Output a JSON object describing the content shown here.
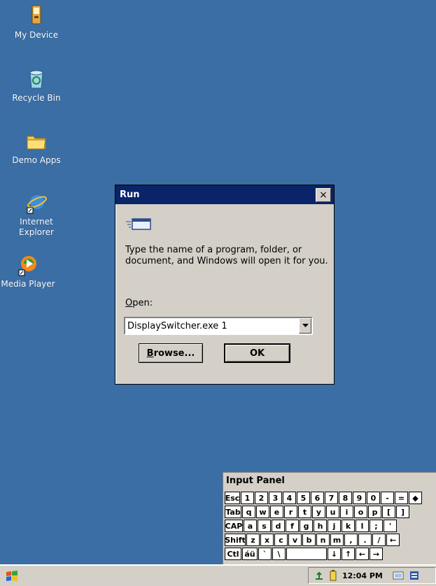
{
  "desktop": {
    "icons": [
      {
        "label": "My Device",
        "icon": "device-icon"
      },
      {
        "label": "Recycle Bin",
        "icon": "recycle-bin-icon"
      },
      {
        "label": "Demo Apps",
        "icon": "folder-icon"
      },
      {
        "label": "Internet Explorer",
        "icon": "internet-explorer-icon"
      },
      {
        "label": "Media Player",
        "icon": "media-player-icon"
      }
    ]
  },
  "run_dialog": {
    "title": "Run",
    "close_label": "×",
    "description": "Type the name of a program, folder, or document, and Windows will open it for you.",
    "open_label_accel": "O",
    "open_label_rest": "pen:",
    "open_value": "DisplaySwitcher.exe 1",
    "browse_accel": "B",
    "browse_rest": "rowse...",
    "ok_label": "OK"
  },
  "input_panel": {
    "title": "Input Panel",
    "rows": [
      [
        "Esc",
        "1",
        "2",
        "3",
        "4",
        "5",
        "6",
        "7",
        "8",
        "9",
        "0",
        "-",
        "=",
        "◆"
      ],
      [
        "Tab",
        "q",
        "w",
        "e",
        "r",
        "t",
        "y",
        "u",
        "i",
        "o",
        "p",
        "[",
        "]"
      ],
      [
        "CAP",
        "a",
        "s",
        "d",
        "f",
        "g",
        "h",
        "j",
        "k",
        "l",
        ";",
        "'"
      ],
      [
        "Shift",
        "z",
        "x",
        "c",
        "v",
        "b",
        "n",
        "m",
        ",",
        ".",
        "/",
        "←"
      ],
      [
        "Ctl",
        "áü",
        "`",
        "\\",
        "",
        "↓",
        "↑",
        "←",
        "→"
      ]
    ]
  },
  "taskbar": {
    "time": "12:04 PM",
    "colors": {
      "desktop": "#3a6ea5",
      "titlebar": "#0a246a",
      "chrome": "#d4d0c8"
    }
  }
}
